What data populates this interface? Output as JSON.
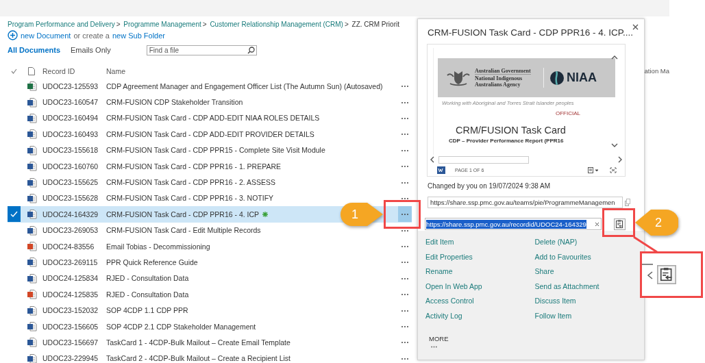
{
  "breadcrumb": {
    "separator": ">",
    "items": [
      {
        "label": "Program Performance and Delivery",
        "kind": "link"
      },
      {
        "label": "Programme Management",
        "kind": "link"
      },
      {
        "label": "Customer Relationship Management (CRM)",
        "kind": "link"
      },
      {
        "label": "ZZ. CRM Priorit",
        "kind": "current"
      }
    ]
  },
  "new_bar": {
    "new_document": "new Document",
    "middle": "or create a",
    "new_folder": "new Sub Folder"
  },
  "views": [
    {
      "label": "All Documents",
      "selected": true
    },
    {
      "label": "Emails Only",
      "selected": false
    }
  ],
  "search": {
    "placeholder": "Find a file"
  },
  "table": {
    "columns": [
      "Record ID",
      "Name"
    ],
    "column_4": "ation Ma",
    "rows": [
      {
        "record_id": "UDOC23-125593",
        "name": "CDP Agreement Manager and Engagement Officer List (The Autumn Sun) (Autosaved)",
        "kind": "excel",
        "selected": false,
        "new": false
      },
      {
        "record_id": "UDOC23-160547",
        "name": "CRM-FUSION CDP Stakeholder Transition",
        "kind": "word",
        "selected": false,
        "new": false
      },
      {
        "record_id": "UDOC23-160494",
        "name": "CRM-FUSION Task Card - CDP ADD-EDIT NIAA ROLES DETAILS",
        "kind": "word",
        "selected": false,
        "new": false
      },
      {
        "record_id": "UDOC23-160493",
        "name": "CRM-FUSION Task Card - CDP ADD-EDIT PROVIDER DETAILS",
        "kind": "word",
        "selected": false,
        "new": false
      },
      {
        "record_id": "UDOC23-155618",
        "name": "CRM-FUSION Task Card - CDP PPR15 - Complete Site Visit Module",
        "kind": "word",
        "selected": false,
        "new": false
      },
      {
        "record_id": "UDOC23-160760",
        "name": "CRM-FUSION Task Card - CDP PPR16 - 1. PREPARE",
        "kind": "word",
        "selected": false,
        "new": false
      },
      {
        "record_id": "UDOC23-155625",
        "name": "CRM-FUSION Task Card - CDP PPR16 - 2. ASSESS",
        "kind": "word",
        "selected": false,
        "new": false
      },
      {
        "record_id": "UDOC23-155628",
        "name": "CRM-FUSION Task Card - CDP PPR16 - 3. NOTIFY",
        "kind": "word",
        "selected": false,
        "new": false
      },
      {
        "record_id": "UDOC24-164329",
        "name": "CRM-FUSION Task Card - CDP PPR16 - 4. ICP",
        "kind": "word",
        "selected": true,
        "new": true
      },
      {
        "record_id": "UDOC23-269053",
        "name": "CRM-FUSION Task Card - Edit Multiple Records",
        "kind": "word",
        "selected": false,
        "new": false
      },
      {
        "record_id": "UDOC24-83556",
        "name": "Email Tobias - Decommissioning",
        "kind": "pdf",
        "selected": false,
        "new": false
      },
      {
        "record_id": "UDOC23-269115",
        "name": "PPR Quick Reference Guide",
        "kind": "word",
        "selected": false,
        "new": false
      },
      {
        "record_id": "UDOC24-125834",
        "name": "RJED - Consultation Data",
        "kind": "word",
        "selected": false,
        "new": false
      },
      {
        "record_id": "UDOC24-125835",
        "name": "RJED - Consultation Data",
        "kind": "pdf",
        "selected": false,
        "new": false
      },
      {
        "record_id": "UDOC23-152032",
        "name": "SOP 4CDP 1.1 CDP PPR",
        "kind": "word",
        "selected": false,
        "new": false
      },
      {
        "record_id": "UDOC23-156605",
        "name": "SOP 4CDP 2.1 CDP Stakeholder Management",
        "kind": "word",
        "selected": false,
        "new": false
      },
      {
        "record_id": "UDOC23-156697",
        "name": "TaskCard 1 - 4CDP-Bulk Mailout – Create Email Template",
        "kind": "word",
        "selected": false,
        "new": false
      },
      {
        "record_id": "UDOC23-229945",
        "name": "TaskCard 2 - 4CDP-Bulk Mailout – Create a Recipient List",
        "kind": "word",
        "selected": false,
        "new": false
      }
    ]
  },
  "popup": {
    "title": "CRM-FUSION Task Card - CDP PPR16 - 4. ICP....",
    "preview": {
      "gov_line": "Australian Government",
      "agency_line_1": "National Indigenous",
      "agency_line_2": "Australians Agency",
      "logo_text": "NIAA",
      "tagline": "Working with Aboriginal and Torres Strait Islander peoples",
      "classification": "OFFICIAL",
      "heading": "CRM/FUSION Task Card",
      "subheading": "CDP – Provider Performance Report (PPR16",
      "page_label": "PAGE 1 OF 6"
    },
    "changed": "Changed by you on 19/07/2024 9:38 AM",
    "url": "https://share.ssp.pmc.gov.au/teams/pie/ProgrammeManagemen",
    "record_url": "https://share.ssp.pmc.gov.au/recordid/UDOC24-164329",
    "record_url_selected": true,
    "action_columns": [
      [
        "Edit Item",
        "Edit Properties",
        "Rename",
        "Open In Web App",
        "Access Control",
        "Activity Log"
      ],
      [
        "Delete (NAP)",
        "Add to Favourites",
        "Share",
        "Send as Attachment",
        "Discuss Item",
        "Follow Item"
      ]
    ],
    "more": "MORE"
  },
  "callouts": [
    {
      "number": "1",
      "kind": "point-right"
    },
    {
      "number": "2",
      "kind": "point-left"
    }
  ]
}
